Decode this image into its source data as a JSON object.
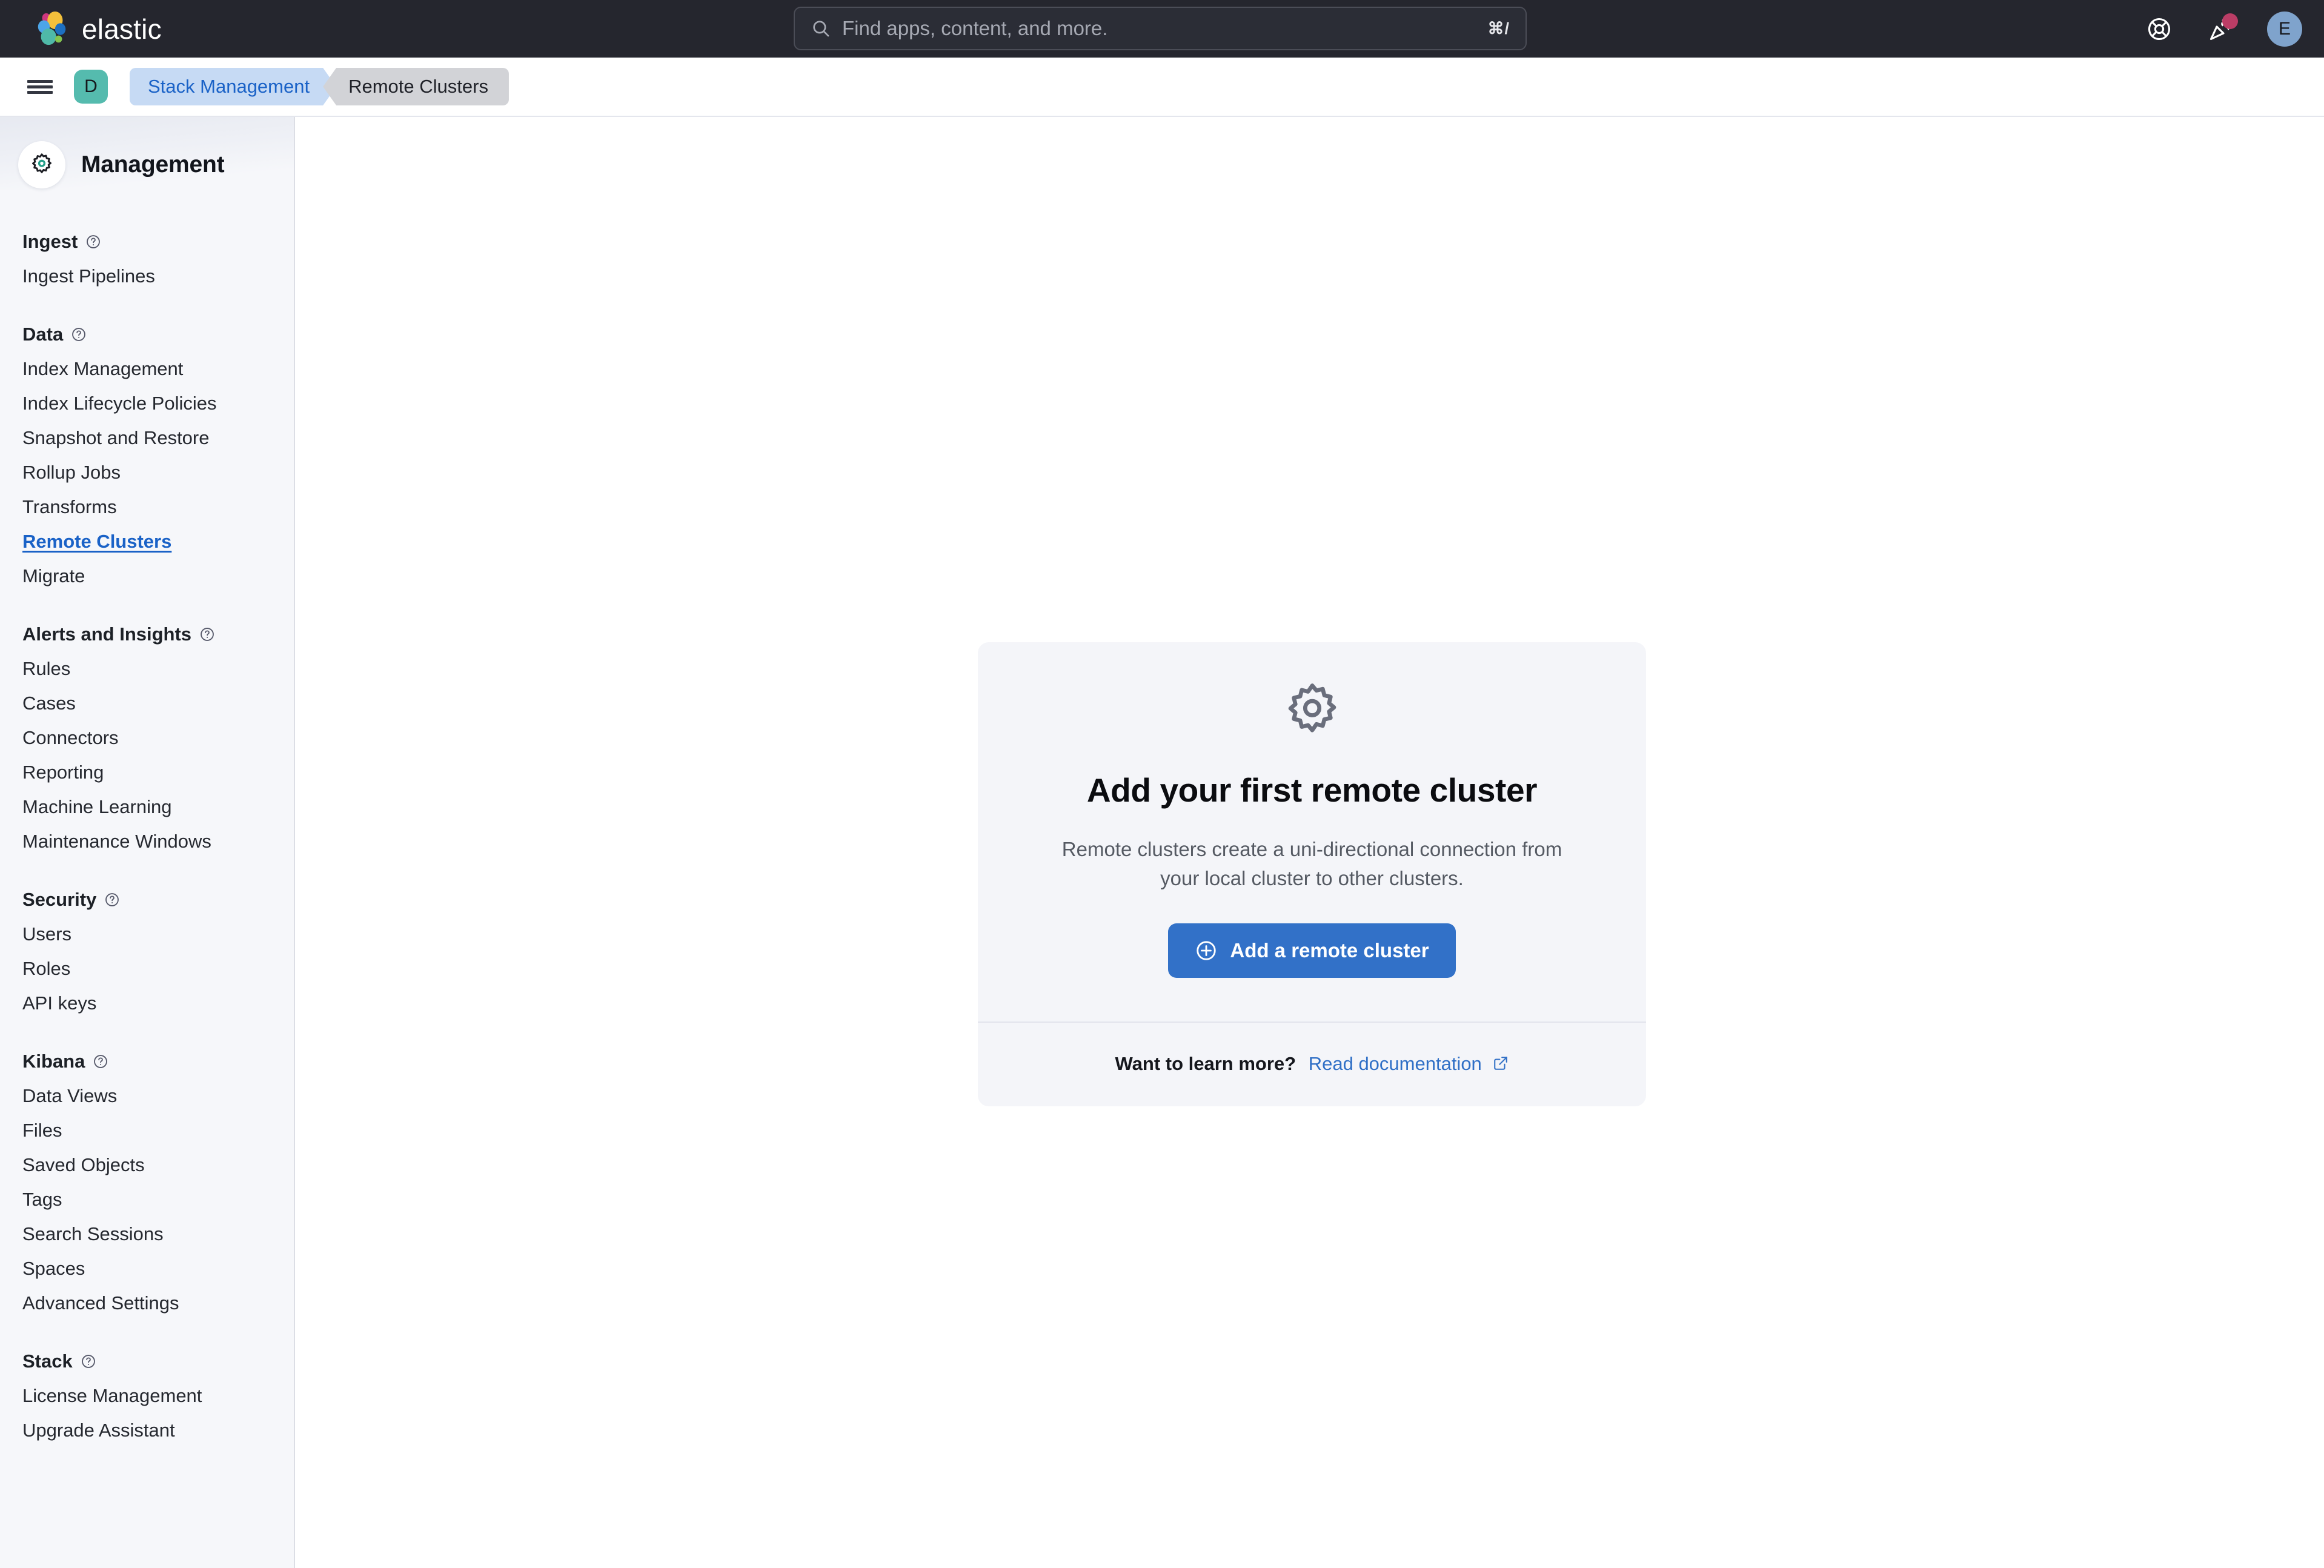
{
  "header": {
    "brand_name": "elastic",
    "search": {
      "placeholder": "Find apps, content, and more.",
      "shortcut": "⌘/"
    },
    "actions": {
      "help_label": "Help",
      "news_label": "News",
      "avatar_initial": "E"
    }
  },
  "breadcrumb_bar": {
    "menu_label": "Toggle navigation",
    "space_initial": "D",
    "crumbs": [
      {
        "label": "Stack Management"
      },
      {
        "label": "Remote Clusters"
      }
    ]
  },
  "sidebar": {
    "title": "Management",
    "groups": [
      {
        "title": "Ingest",
        "items": [
          {
            "label": "Ingest Pipelines",
            "active": false
          }
        ]
      },
      {
        "title": "Data",
        "items": [
          {
            "label": "Index Management",
            "active": false
          },
          {
            "label": "Index Lifecycle Policies",
            "active": false
          },
          {
            "label": "Snapshot and Restore",
            "active": false
          },
          {
            "label": "Rollup Jobs",
            "active": false
          },
          {
            "label": "Transforms",
            "active": false
          },
          {
            "label": "Remote Clusters",
            "active": true
          },
          {
            "label": "Migrate",
            "active": false
          }
        ]
      },
      {
        "title": "Alerts and Insights",
        "items": [
          {
            "label": "Rules",
            "active": false
          },
          {
            "label": "Cases",
            "active": false
          },
          {
            "label": "Connectors",
            "active": false
          },
          {
            "label": "Reporting",
            "active": false
          },
          {
            "label": "Machine Learning",
            "active": false
          },
          {
            "label": "Maintenance Windows",
            "active": false
          }
        ]
      },
      {
        "title": "Security",
        "items": [
          {
            "label": "Users",
            "active": false
          },
          {
            "label": "Roles",
            "active": false
          },
          {
            "label": "API keys",
            "active": false
          }
        ]
      },
      {
        "title": "Kibana",
        "items": [
          {
            "label": "Data Views",
            "active": false
          },
          {
            "label": "Files",
            "active": false
          },
          {
            "label": "Saved Objects",
            "active": false
          },
          {
            "label": "Tags",
            "active": false
          },
          {
            "label": "Search Sessions",
            "active": false
          },
          {
            "label": "Spaces",
            "active": false
          },
          {
            "label": "Advanced Settings",
            "active": false
          }
        ]
      },
      {
        "title": "Stack",
        "items": [
          {
            "label": "License Management",
            "active": false
          },
          {
            "label": "Upgrade Assistant",
            "active": false
          }
        ]
      }
    ]
  },
  "main": {
    "empty_state": {
      "title": "Add your first remote cluster",
      "description": "Remote clusters create a uni-directional connection from your local cluster to other clusters.",
      "button_label": "Add a remote cluster",
      "footer_question": "Want to learn more?",
      "footer_link": "Read documentation"
    }
  },
  "colors": {
    "header_bg": "#25262E",
    "accent_blue": "#3271C8",
    "link_blue": "#2F6FC6",
    "sidebar_bg": "#F6F7FA",
    "panel_bg": "#F4F5F9",
    "space_avatar": "#55BBAE",
    "notification_dot": "#BB3D66",
    "user_avatar": "#7FA3CC"
  }
}
